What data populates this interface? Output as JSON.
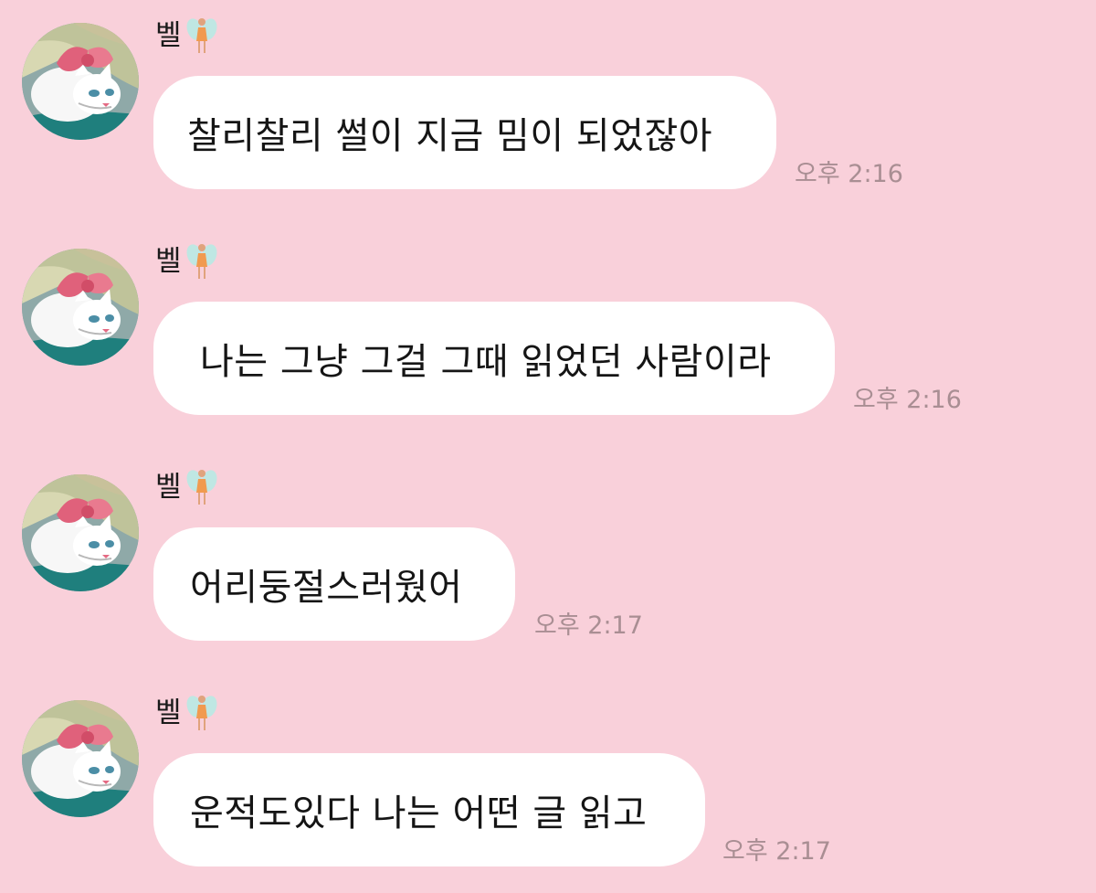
{
  "theme": {
    "background": "#f9d0da",
    "bubble": "#ffffff",
    "text": "#151515",
    "time": "#a98e93"
  },
  "messages": [
    {
      "sender": "벨",
      "sender_icon": "fairy-icon",
      "avatar_icon": "white-cat-with-pink-bow-avatar",
      "text": "찰리찰리 썰이 지금 밈이 되었잖아",
      "time": "오후 2:16"
    },
    {
      "sender": "벨",
      "sender_icon": "fairy-icon",
      "avatar_icon": "white-cat-with-pink-bow-avatar",
      "text": "나는 그냥 그걸 그때 읽었던 사람이라",
      "time": "오후 2:16"
    },
    {
      "sender": "벨",
      "sender_icon": "fairy-icon",
      "avatar_icon": "white-cat-with-pink-bow-avatar",
      "text": "어리둥절스러웠어",
      "time": "오후 2:17"
    },
    {
      "sender": "벨",
      "sender_icon": "fairy-icon",
      "avatar_icon": "white-cat-with-pink-bow-avatar",
      "text": "운적도있다 나는 어떤 글 읽고",
      "time": "오후 2:17"
    }
  ]
}
